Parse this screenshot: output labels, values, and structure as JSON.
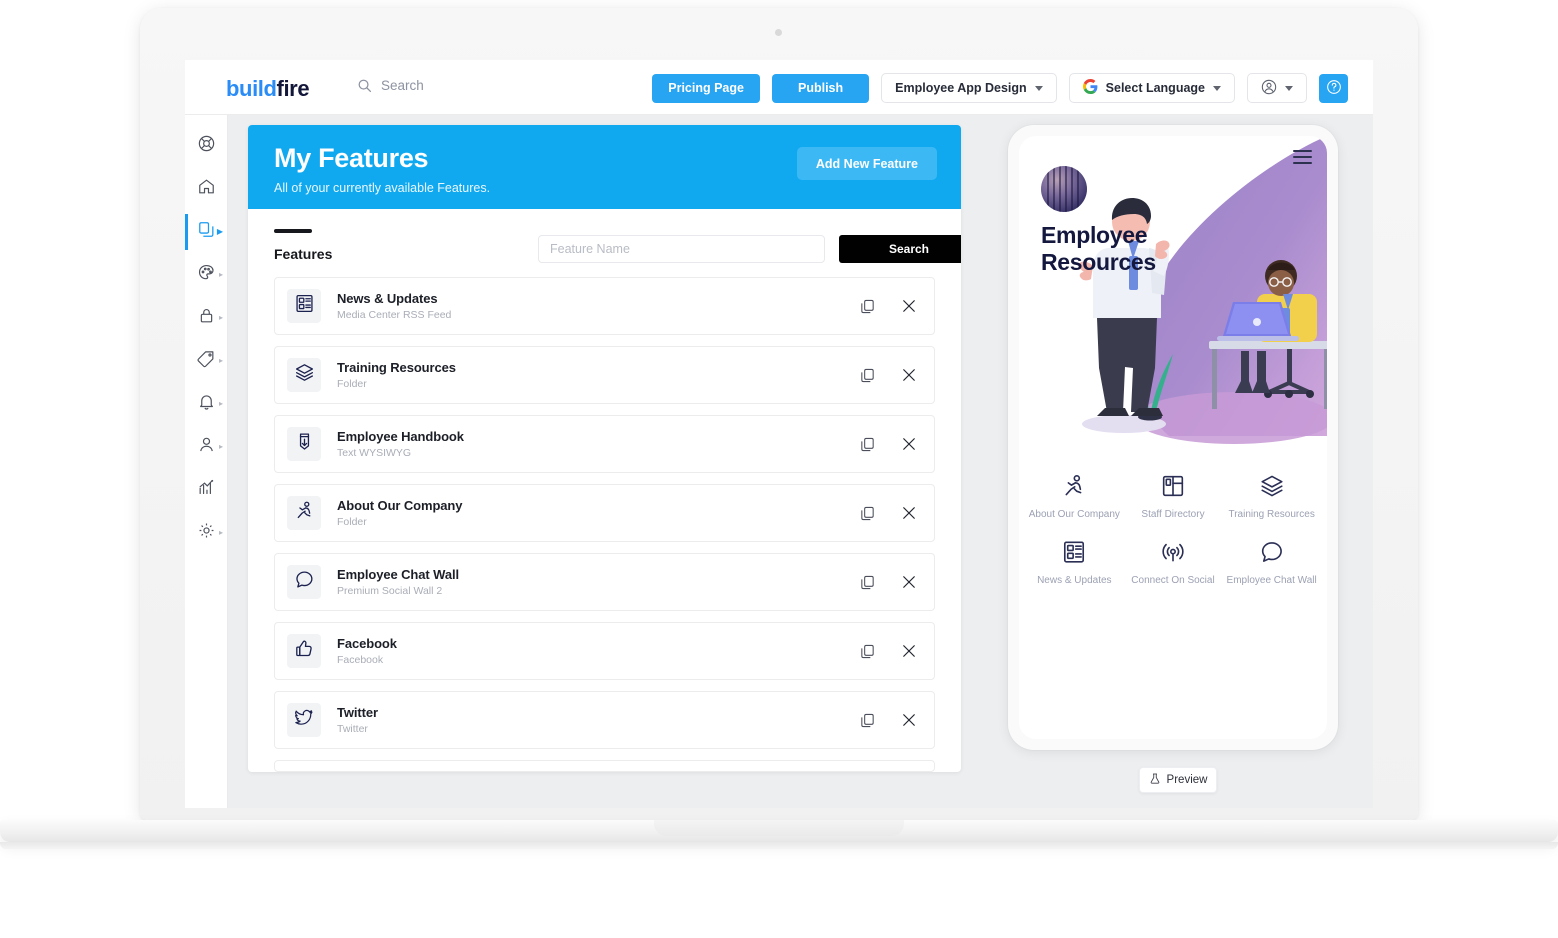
{
  "header": {
    "logo_build": "build",
    "logo_fire": "fire",
    "search_placeholder": "Search",
    "pricing_button": "Pricing Page",
    "publish_button": "Publish",
    "app_design_select": "Employee App Design",
    "language_select": "Select Language",
    "google_mark": "G"
  },
  "sidebar": {
    "items": [
      {
        "name": "lifebuoy-icon",
        "expandable": false,
        "active": false
      },
      {
        "name": "home-icon",
        "expandable": false,
        "active": false
      },
      {
        "name": "layers-copy-icon",
        "expandable": true,
        "active": true
      },
      {
        "name": "palette-icon",
        "expandable": true,
        "active": false
      },
      {
        "name": "lock-icon",
        "expandable": true,
        "active": false
      },
      {
        "name": "tag-icon",
        "expandable": true,
        "active": false
      },
      {
        "name": "bell-icon",
        "expandable": true,
        "active": false
      },
      {
        "name": "user-icon",
        "expandable": true,
        "active": false
      },
      {
        "name": "analytics-icon",
        "expandable": false,
        "active": false
      },
      {
        "name": "gear-icon",
        "expandable": true,
        "active": false
      }
    ]
  },
  "banner": {
    "title": "My Features",
    "subtitle": "All of your currently available Features.",
    "add_button": "Add New Feature"
  },
  "toolbar": {
    "tab_label": "Features",
    "input_placeholder": "Feature Name",
    "input_value": "",
    "search_button": "Search"
  },
  "features": [
    {
      "name": "News & Updates",
      "type": "Media Center RSS Feed",
      "icon": "news-list-icon"
    },
    {
      "name": "Training Resources",
      "type": "Folder",
      "icon": "layers-icon"
    },
    {
      "name": "Employee Handbook",
      "type": "Text WYSIWYG",
      "icon": "book-download-icon"
    },
    {
      "name": "About Our Company",
      "type": "Folder",
      "icon": "running-person-icon"
    },
    {
      "name": "Employee Chat Wall",
      "type": "Premium Social Wall 2",
      "icon": "speech-bubble-icon"
    },
    {
      "name": "Facebook",
      "type": "Facebook",
      "icon": "thumbs-up-icon"
    },
    {
      "name": "Twitter",
      "type": "Twitter",
      "icon": "twitter-bird-icon"
    }
  ],
  "row_actions": {
    "duplicate": "duplicate-icon",
    "remove": "close-icon"
  },
  "phone": {
    "app_title_line1": "Employee",
    "app_title_line2": "Resources",
    "menu_icon": "hamburger-menu-icon",
    "tiles": [
      {
        "label": "About Our Company",
        "icon": "running-person-icon"
      },
      {
        "label": "Staff Directory",
        "icon": "layout-grid-icon"
      },
      {
        "label": "Training Resources",
        "icon": "layers-icon"
      },
      {
        "label": "News & Updates",
        "icon": "news-list-icon"
      },
      {
        "label": "Connect On Social",
        "icon": "broadcast-icon"
      },
      {
        "label": "Employee Chat Wall",
        "icon": "speech-bubble-icon"
      }
    ],
    "preview_button": "Preview",
    "preview_icon": "flask-icon"
  },
  "colors": {
    "brand_blue": "#27a4f2",
    "banner_blue": "#10a9f0",
    "add_button_blue": "#3cb8f5",
    "search_black": "#010101",
    "icon_navy": "#1c2250",
    "muted_text": "#a9adb6"
  }
}
